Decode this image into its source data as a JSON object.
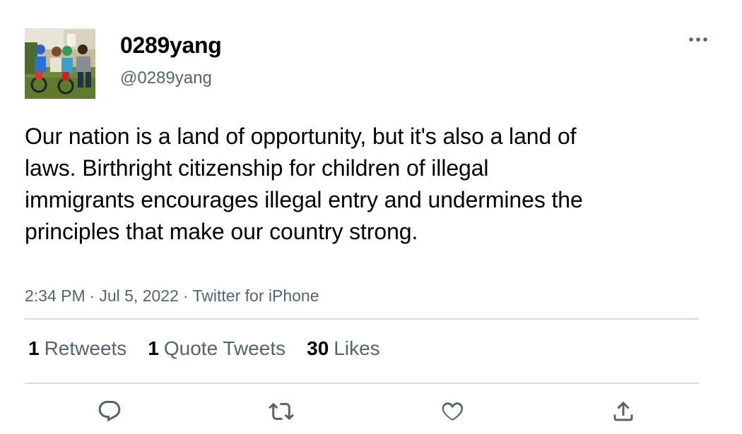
{
  "tweet": {
    "author": {
      "display_name": "0289yang",
      "handle": "@0289yang"
    },
    "text": "Our nation is a land of opportunity, but it's also a land of laws. Birthright citizenship for children of illegal immigrants encourages illegal entry and undermines the principles that make our country strong.",
    "meta": {
      "time": "2:34 PM",
      "separator": "·",
      "date": "Jul 5, 2022",
      "source": "Twitter for iPhone"
    },
    "stats": {
      "retweets_count": "1",
      "retweets_label": "Retweets",
      "quotes_count": "1",
      "quotes_label": "Quote Tweets",
      "likes_count": "30",
      "likes_label": "Likes"
    }
  },
  "icons": {
    "more": "more-horizontal-icon",
    "reply": "reply-icon",
    "retweet": "retweet-icon",
    "like": "heart-icon",
    "share": "share-icon"
  },
  "colors": {
    "text_primary": "#0f1419",
    "text_secondary": "#536471",
    "divider": "#d9dde0"
  }
}
